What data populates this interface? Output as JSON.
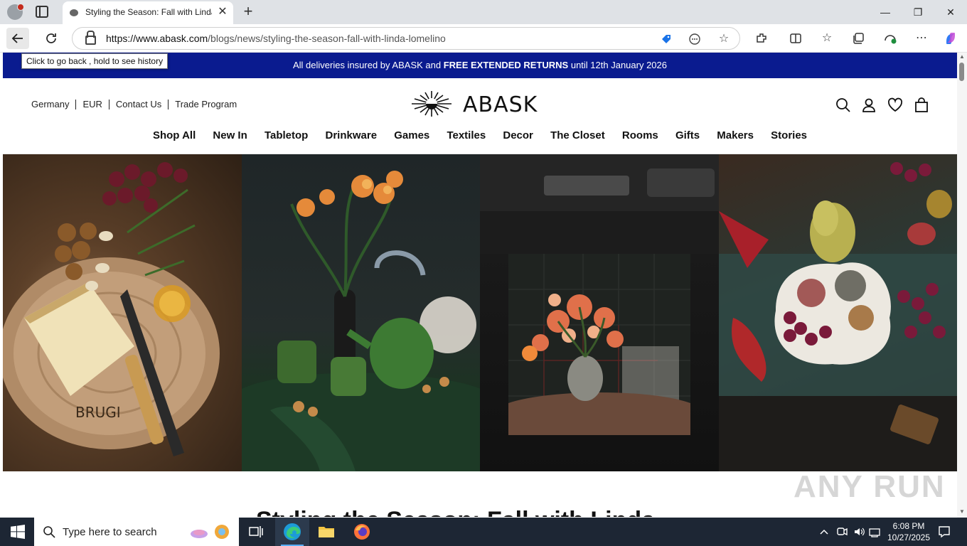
{
  "browser": {
    "tab_title": "Styling the Season: Fall with Linda Lomelino",
    "url_domain": "https://www.abask.com",
    "url_path": "/blogs/news/styling-the-season-fall-with-linda-lomelino",
    "tooltip": "Click to go back , hold to see history"
  },
  "announcement": {
    "pre": "All deliveries insured by ABASK and ",
    "bold": "FREE EXTENDED RETURNS",
    "post": " until 12th January 2026"
  },
  "header": {
    "utility": [
      "Germany",
      "EUR",
      "Contact Us",
      "Trade Program"
    ],
    "logo_text": "ABASK",
    "nav": [
      "Shop All",
      "New In",
      "Tabletop",
      "Drinkware",
      "Games",
      "Textiles",
      "Decor",
      "The Closet",
      "Rooms",
      "Gifts",
      "Makers",
      "Stories"
    ]
  },
  "hero": {
    "cheese_board_carving": "BRUGI"
  },
  "article": {
    "title": "Styling the Season: Fall with Linda Lomelino"
  },
  "watermark": "ANY RUN",
  "taskbar": {
    "search_placeholder": "Type here to search",
    "time": "6:08 PM",
    "date": "10/27/2025"
  },
  "colors": {
    "announcement_bg": "#0a1b8f",
    "taskbar_bg": "#1d2634"
  }
}
